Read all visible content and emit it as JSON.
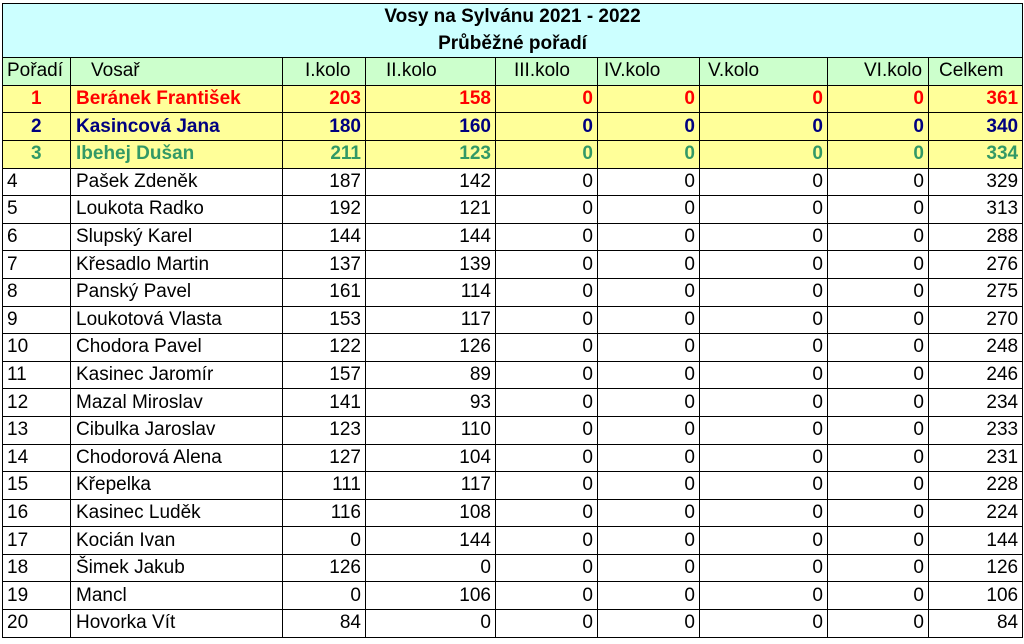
{
  "title": "Vosy na Sylvánu 2021 - 2022",
  "subtitle": "Průběžné pořadí",
  "headers": [
    "Pořadí",
    "Vosař",
    "I.kolo",
    "II.kolo",
    "III.kolo",
    "IV.kolo",
    "V.kolo",
    "VI.kolo",
    "Celkem"
  ],
  "colors": {
    "title_bg": "#ccffff",
    "header_bg": "#ccffcc",
    "podium_bg": "#ffff99",
    "first": "#ff0000",
    "second": "#000080",
    "third": "#339966"
  },
  "rows": [
    [
      "1",
      "Beránek František",
      "203",
      "158",
      "0",
      "0",
      "0",
      "0",
      "361"
    ],
    [
      "2",
      "Kasincová Jana",
      "180",
      "160",
      "0",
      "0",
      "0",
      "0",
      "340"
    ],
    [
      "3",
      "Ibehej Dušan",
      "211",
      "123",
      "0",
      "0",
      "0",
      "0",
      "334"
    ],
    [
      "4",
      "Pašek Zdeněk",
      "187",
      "142",
      "0",
      "0",
      "0",
      "0",
      "329"
    ],
    [
      "5",
      "Loukota Radko",
      "192",
      "121",
      "0",
      "0",
      "0",
      "0",
      "313"
    ],
    [
      "6",
      "Slupský Karel",
      "144",
      "144",
      "0",
      "0",
      "0",
      "0",
      "288"
    ],
    [
      "7",
      "Křesadlo Martin",
      "137",
      "139",
      "0",
      "0",
      "0",
      "0",
      "276"
    ],
    [
      "8",
      "Panský Pavel",
      "161",
      "114",
      "0",
      "0",
      "0",
      "0",
      "275"
    ],
    [
      "9",
      "Loukotová Vlasta",
      "153",
      "117",
      "0",
      "0",
      "0",
      "0",
      "270"
    ],
    [
      "10",
      "Chodora Pavel",
      "122",
      "126",
      "0",
      "0",
      "0",
      "0",
      "248"
    ],
    [
      "11",
      "Kasinec Jaromír",
      "157",
      "89",
      "0",
      "0",
      "0",
      "0",
      "246"
    ],
    [
      "12",
      "Mazal Miroslav",
      "141",
      "93",
      "0",
      "0",
      "0",
      "0",
      "234"
    ],
    [
      "13",
      "Cibulka Jaroslav",
      "123",
      "110",
      "0",
      "0",
      "0",
      "0",
      "233"
    ],
    [
      "14",
      "Chodorová Alena",
      "127",
      "104",
      "0",
      "0",
      "0",
      "0",
      "231"
    ],
    [
      "15",
      "Křepelka",
      "111",
      "117",
      "0",
      "0",
      "0",
      "0",
      "228"
    ],
    [
      "16",
      "Kasinec Luděk",
      "116",
      "108",
      "0",
      "0",
      "0",
      "0",
      "224"
    ],
    [
      "17",
      "Kocián Ivan",
      "0",
      "144",
      "0",
      "0",
      "0",
      "0",
      "144"
    ],
    [
      "18",
      "Šimek Jakub",
      "126",
      "0",
      "0",
      "0",
      "0",
      "0",
      "126"
    ],
    [
      "19",
      "Mancl",
      "0",
      "106",
      "0",
      "0",
      "0",
      "0",
      "106"
    ],
    [
      "20",
      "Hovorka Vít",
      "84",
      "0",
      "0",
      "0",
      "0",
      "0",
      "84"
    ]
  ]
}
